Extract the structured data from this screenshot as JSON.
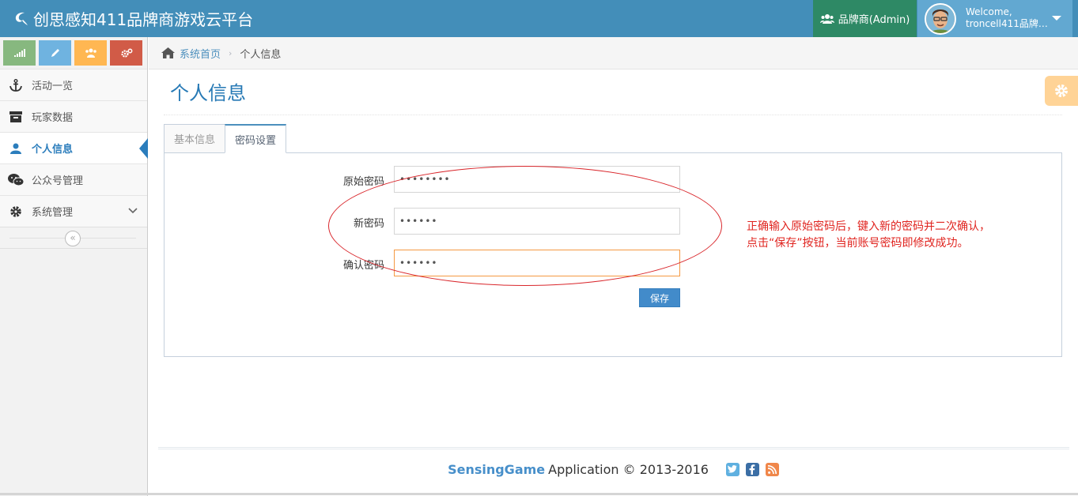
{
  "app": {
    "title": "创思感知411品牌商游戏云平台",
    "role_label": "品牌商(Admin)",
    "welcome": "Welcome,",
    "username": "troncell411品牌…"
  },
  "sidebar": {
    "shortcut_colors": [
      "#87b87f",
      "#6fb3e0",
      "#ffb752",
      "#d15b47"
    ],
    "items": [
      {
        "label": "活动一览",
        "icon": "anchor-icon"
      },
      {
        "label": "玩家数据",
        "icon": "archive-icon"
      },
      {
        "label": "个人信息",
        "icon": "user-icon",
        "active": true
      },
      {
        "label": "公众号管理",
        "icon": "wechat-icon"
      },
      {
        "label": "系统管理",
        "icon": "gear-icon",
        "expandable": true
      }
    ]
  },
  "breadcrumb": {
    "home": "系统首页",
    "current": "个人信息"
  },
  "page": {
    "title": "个人信息",
    "tabs": [
      {
        "label": "基本信息",
        "active": false
      },
      {
        "label": "密码设置",
        "active": true
      }
    ]
  },
  "form": {
    "old_password": {
      "label": "原始密码",
      "value": "••••••••"
    },
    "new_password": {
      "label": "新密码",
      "value": "••••••"
    },
    "confirm_password": {
      "label": "确认密码",
      "value": "••••••"
    },
    "save_label": "保存"
  },
  "annotation": {
    "line1": "正确输入原始密码后，键入新的密码并二次确认，",
    "line2": "点击“保存”按钮，当前账号密码即修改成功。"
  },
  "footer": {
    "brand": "SensingGame",
    "text": "Application © 2013-2016"
  }
}
